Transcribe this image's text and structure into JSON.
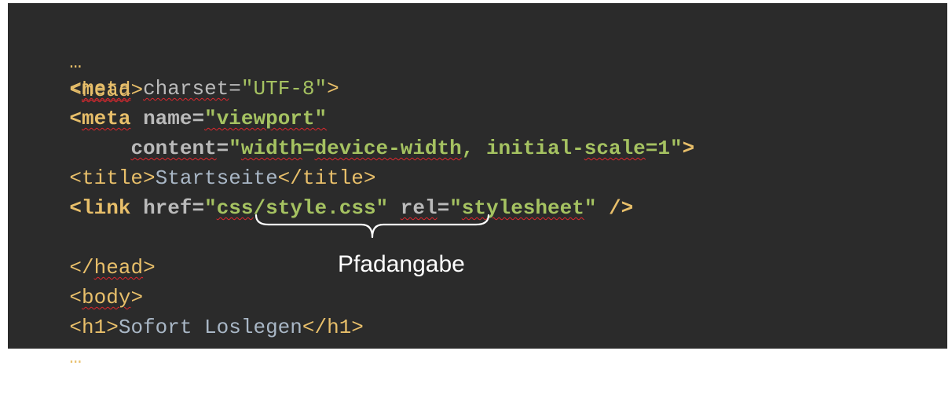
{
  "snippet": {
    "ellipsis_top": "…",
    "head_open": {
      "lt": "<",
      "name": "head",
      "gt": ">"
    },
    "meta_charset": {
      "open": "<",
      "name": "meta",
      "attr": "charset",
      "eq": "=",
      "value": "\"UTF-8\"",
      "close": ">"
    },
    "meta_viewport": {
      "open": "<",
      "name": "meta",
      "attr1": "name",
      "eq": "=",
      "value1": "\"viewport\"",
      "attr2": "content",
      "value2_q1": "\"",
      "value2_w1": "width",
      "value2_eq": "=",
      "value2_w2": "device-width",
      "value2_rest": ", initial-",
      "value2_w3": "scale",
      "value2_end": "=1\"",
      "close": ">"
    },
    "title": {
      "open": "<title>",
      "text": "Startseite",
      "close": "</title>"
    },
    "link": {
      "open": "<",
      "name": "link",
      "attr1": "href",
      "eq": "=",
      "value1_q": "\"",
      "value1_a": "css",
      "value1_b": "/style.css\"",
      "attr2": "rel",
      "value2_q": "\"",
      "value2_a": "stylesheet",
      "value2_b": "\"",
      "close": "/>"
    },
    "head_close": {
      "lt": "</",
      "name": "head",
      "gt": ">"
    },
    "body_open": {
      "lt": "<",
      "name": "body",
      "gt": ">"
    },
    "h1": {
      "open": "<h1>",
      "text": "Sofort Loslegen",
      "close": "</h1>"
    },
    "ellipsis_bottom": "…"
  },
  "annotation": {
    "label": "Pfadangabe"
  }
}
